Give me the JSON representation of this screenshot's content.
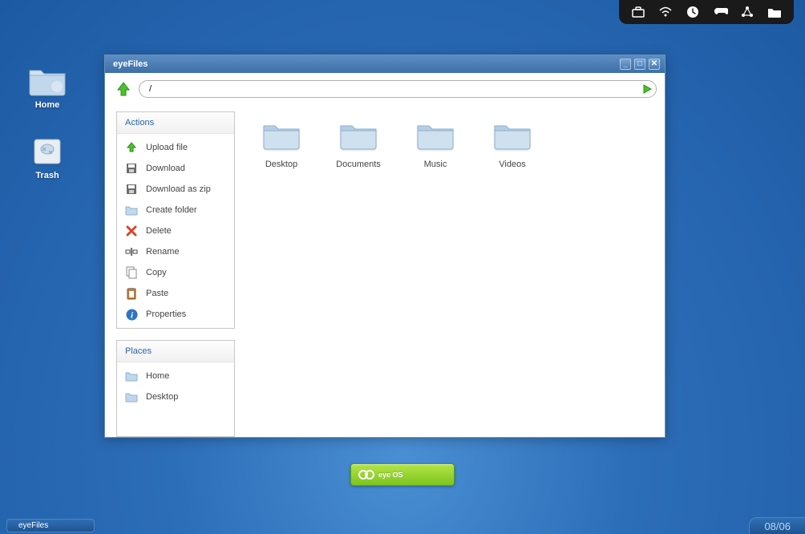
{
  "desktop": {
    "icons": [
      {
        "name": "home",
        "label": "Home"
      },
      {
        "name": "trash",
        "label": "Trash"
      }
    ]
  },
  "systray": {
    "icons": [
      "briefcase-icon",
      "wifi-icon",
      "clock-icon",
      "gamepad-icon",
      "share-icon",
      "folder-icon"
    ]
  },
  "window": {
    "title": "eyeFiles",
    "path": "/",
    "sidebar": {
      "actions_header": "Actions",
      "places_header": "Places",
      "actions": [
        {
          "label": "Upload file",
          "icon": "upload"
        },
        {
          "label": "Download",
          "icon": "save"
        },
        {
          "label": "Download as zip",
          "icon": "save"
        },
        {
          "label": "Create folder",
          "icon": "folder"
        },
        {
          "label": "Delete",
          "icon": "delete"
        },
        {
          "label": "Rename",
          "icon": "rename"
        },
        {
          "label": "Copy",
          "icon": "copy"
        },
        {
          "label": "Paste",
          "icon": "paste"
        },
        {
          "label": "Properties",
          "icon": "info"
        }
      ],
      "places": [
        {
          "label": "Home",
          "icon": "folder"
        },
        {
          "label": "Desktop",
          "icon": "folder"
        }
      ]
    },
    "folders": [
      {
        "label": "Desktop"
      },
      {
        "label": "Documents"
      },
      {
        "label": "Music"
      },
      {
        "label": "Videos"
      }
    ]
  },
  "launcher": {
    "label": "eye OS"
  },
  "taskbar": {
    "tasks": [
      {
        "label": "eyeFiles"
      }
    ],
    "clock": "08/06"
  }
}
